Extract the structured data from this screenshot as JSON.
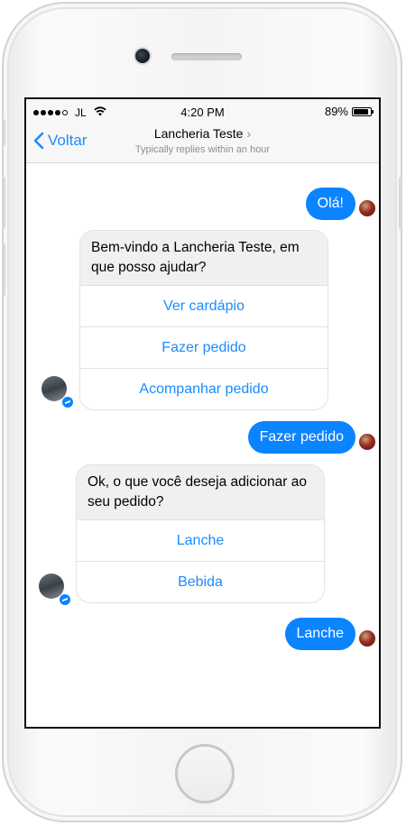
{
  "status_bar": {
    "carrier": "JL",
    "time": "4:20 PM",
    "battery": "89%",
    "battery_level": 0.89
  },
  "header": {
    "back_label": "Voltar",
    "title": "Lancheria Teste",
    "subtitle": "Typically replies within an hour"
  },
  "messages": {
    "m1": {
      "text": "Olá!"
    },
    "m2": {
      "text": "Bem-vindo a Lancheria Teste, em que posso ajudar?",
      "buttons": [
        "Ver cardápio",
        "Fazer pedido",
        "Acompanhar pedido"
      ]
    },
    "m3": {
      "text": "Fazer pedido"
    },
    "m4": {
      "text": "Ok, o que você deseja adicionar ao seu pedido?",
      "buttons": [
        "Lanche",
        "Bebida"
      ]
    },
    "m5": {
      "text": "Lanche"
    }
  },
  "colors": {
    "accent": "#1a8cff",
    "outgoing_bubble": "#0a84ff",
    "incoming_bubble": "#f0f0f0"
  },
  "icons": {
    "back": "chevron-left-icon",
    "messenger_badge": "messenger-icon"
  }
}
